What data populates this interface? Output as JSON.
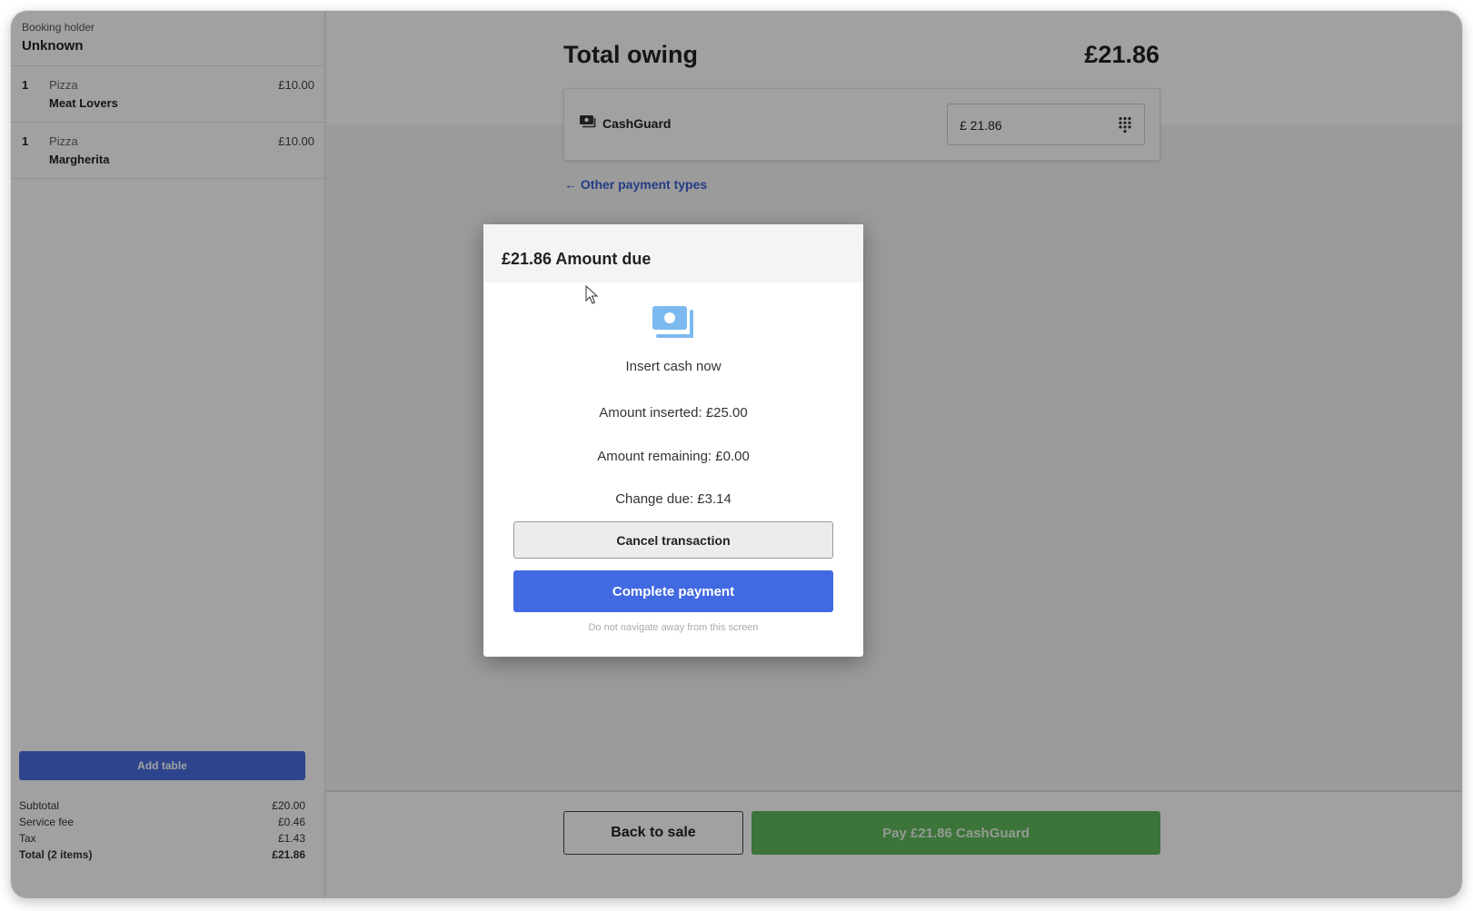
{
  "sidebar": {
    "booking_holder_label": "Booking holder",
    "booking_holder_name": "Unknown",
    "items": [
      {
        "qty": "1",
        "category": "Pizza",
        "name": "Meat Lovers",
        "price": "£10.00"
      },
      {
        "qty": "1",
        "category": "Pizza",
        "name": "Margherita",
        "price": "£10.00"
      }
    ],
    "add_table_label": "Add table",
    "totals": {
      "subtotal_label": "Subtotal",
      "subtotal": "£20.00",
      "service_fee_label": "Service fee",
      "service_fee": "£0.46",
      "tax_label": "Tax",
      "tax": "£1.43",
      "total_label": "Total (2 items)",
      "total": "£21.86"
    }
  },
  "main": {
    "total_owing_label": "Total owing",
    "total_owing_value": "£21.86",
    "payment_method": {
      "icon": "cash-icon",
      "label": "CashGuard"
    },
    "amount_field": {
      "value": "£ 21.86",
      "icon": "keypad-icon"
    },
    "other_payment_types": "← Other payment types",
    "back_to_sale_label": "Back to sale",
    "pay_label": "Pay £21.86 CashGuard"
  },
  "modal": {
    "title": "£21.86 Amount due",
    "icon": "cash-icon",
    "instruction": "Insert cash now",
    "amount_inserted": "Amount inserted: £25.00",
    "amount_remaining": "Amount remaining: £0.00",
    "change_due": "Change due: £3.14",
    "cancel_label": "Cancel transaction",
    "complete_label": "Complete payment",
    "warning": "Do not navigate away from this screen"
  },
  "colors": {
    "primary": "#4169e1",
    "pay_green": "#5fb85c",
    "link": "#3a5fd6",
    "cash_icon": "#7cb9ee"
  }
}
